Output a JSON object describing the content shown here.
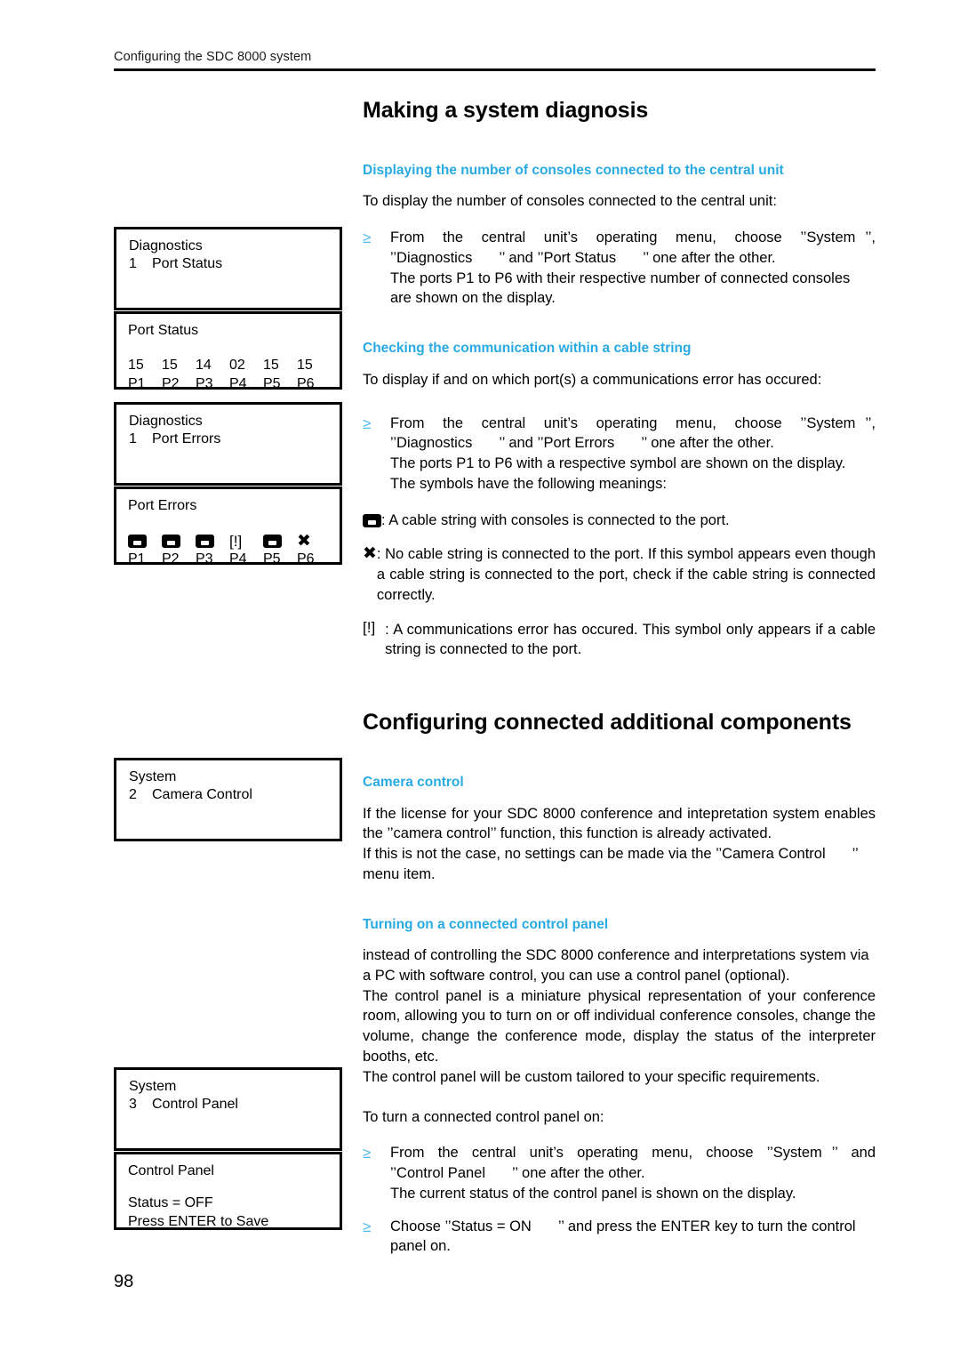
{
  "page": {
    "running_header": "Configuring the SDC 8000 system",
    "page_number": "98",
    "accent_color": "#29aae2",
    "bullet_marker": "≥"
  },
  "sections": [
    {
      "id": "making-a-system-diagnosis",
      "title": "Making a system diagnosis",
      "subsections": [
        {
          "id": "displaying-number-of-consoles",
          "heading": "Displaying the number of consoles connected to the central unit",
          "intro": "To display the number of consoles connected to the central unit:",
          "step": {
            "line1_a": "From the central unit’s operating menu, choose ’’System",
            "line1_b": "’’,",
            "line2_a": "’’Diagnostics",
            "line2_b": "’’ and ’’Port Status",
            "line2_c": "’’ one after the other.",
            "line3": "The ports P1 to P6 with their respective number of connected consoles",
            "line4": "are shown on the display."
          }
        },
        {
          "id": "checking-communication",
          "heading": "Checking the communication within a cable string",
          "intro": "To display if and on which port(s) a communications error has occured:",
          "step": {
            "line1_a": "From the central unit’s operating menu, choose ’’System",
            "line1_b": "’’,",
            "line2_a": "’’Diagnostics",
            "line2_b": "’’ and ’’Port Errors",
            "line2_c": "’’ one after the other.",
            "line3": "The ports P1 to P6 with a respective symbol are shown on the display.",
            "line4": "The symbols have the following meanings:"
          },
          "legend": [
            {
              "symbol": "console-icon",
              "text": ": A cable string with consoles is connected to the port."
            },
            {
              "symbol": "cross-icon",
              "text": ": No cable string is connected to the port. If this symbol appears even though a cable string is connected to the port, check if the cable string is connected correctly."
            },
            {
              "symbol": "error-bracket-icon",
              "symbol_text": "[!]",
              "text": ": A communications error has occured. This symbol only appears if a cable string is connected to the port."
            }
          ]
        }
      ]
    },
    {
      "id": "configuring-connected-additional-components",
      "title": "Configuring connected additional components",
      "subsections": [
        {
          "id": "camera-control",
          "heading": "Camera control",
          "paragraph_a": "If the license for your SDC 8000 conference and intepretation system enables the ’’camera control’’ function, this function is already activated.",
          "paragraph_b1": "If this is not the case, no settings can be made via the ’’Camera Control",
          "paragraph_b2": "’’",
          "paragraph_b3": "menu item."
        },
        {
          "id": "turning-on-control-panel",
          "heading": "Turning on a connected control panel",
          "paragraph_1": "instead of controlling the SDC 8000 conference and interpretations system via a PC with software control, you can use a control panel (optional).",
          "paragraph_2": "The control panel is a miniature physical representation of your conference room, allowing you to turn on or off individual conference consoles, change the volume, change the conference mode, display the status of the interpreter booths, etc.",
          "paragraph_3": "The control panel will be custom tailored to your specific requirements.",
          "intro": "To turn a connected control panel on:",
          "step1": {
            "line1_a": "From the central unit’s operating menu, choose ’’System",
            "line1_b": "’’ and",
            "line2_a": "’’Control Panel",
            "line2_b": "’’ one after the other.",
            "line3": "The current status of the control panel is shown on the display."
          },
          "step2": {
            "line1_a": "Choose ’’Status = ON",
            "line1_b": "’’ and press the ENTER key to turn the control",
            "line2": "panel on."
          }
        }
      ]
    }
  ],
  "displays": [
    {
      "id": "diagnostics-port-status",
      "line1": "Diagnostics",
      "index": "1",
      "line2": "Port Status"
    },
    {
      "id": "port-status",
      "title": "Port Status",
      "ports": [
        "P1",
        "P2",
        "P3",
        "P4",
        "P5",
        "P6"
      ],
      "values": [
        "15",
        "15",
        "14",
        "02",
        "15",
        "15"
      ]
    },
    {
      "id": "diagnostics-port-errors",
      "line1": "Diagnostics",
      "index": "1",
      "line2": "Port Errors"
    },
    {
      "id": "port-errors",
      "title": "Port Errors",
      "ports": [
        "P1",
        "P2",
        "P3",
        "P4",
        "P5",
        "P6"
      ],
      "symbols": [
        "console",
        "console",
        "console",
        "error",
        "console",
        "cross"
      ],
      "error_text": "[!]",
      "cross_text": "✖"
    },
    {
      "id": "system-camera-control",
      "line1": "System",
      "index": "2",
      "line2": "Camera Control"
    },
    {
      "id": "system-control-panel",
      "line1": "System",
      "index": "3",
      "line2": "Control Panel"
    },
    {
      "id": "control-panel-status",
      "title": "Control Panel",
      "status": "Status = OFF",
      "save_hint": "Press ENTER to Save"
    }
  ]
}
